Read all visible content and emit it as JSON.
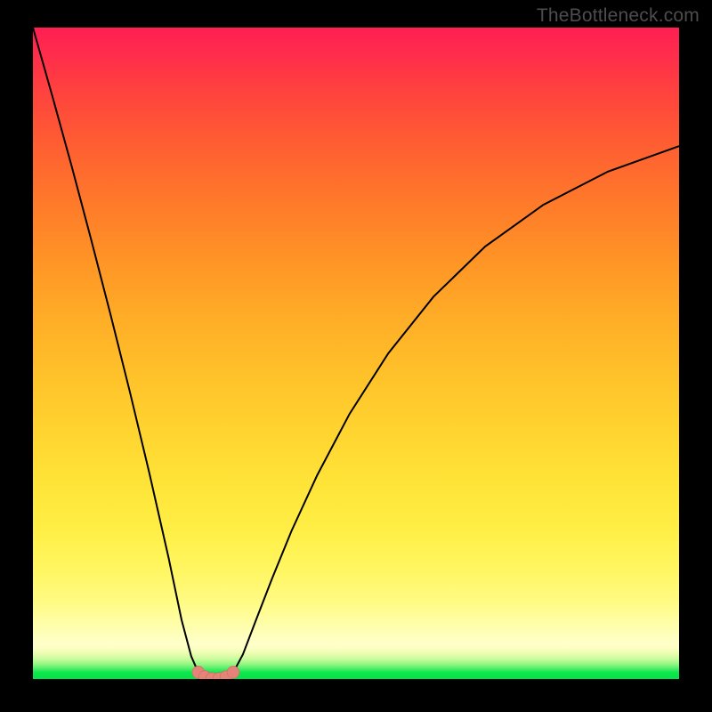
{
  "watermark": "TheBottleneck.com",
  "colors": {
    "frame": "#000000",
    "curve": "#000000",
    "marker_fill": "#e48377",
    "marker_stroke": "#cf6b60"
  },
  "chart_data": {
    "type": "line",
    "title": "",
    "xlabel": "",
    "ylabel": "",
    "xlim": [
      0,
      100
    ],
    "ylim": [
      0,
      100
    ],
    "note": "Two monotone curves meeting near x≈25–31 at y≈0 with a short flat-bottom arc. Values estimated from pixel positions; no labeled axes.",
    "series": [
      {
        "name": "left-branch",
        "x": [
          0,
          3,
          6,
          9,
          12,
          15,
          18,
          21,
          23,
          24.5,
          25.6
        ],
        "y": [
          100,
          89.5,
          78.7,
          67.5,
          56.0,
          44.1,
          31.7,
          18.6,
          9.1,
          3.5,
          1.0
        ]
      },
      {
        "name": "right-branch",
        "x": [
          31.0,
          32.5,
          34.5,
          37,
          40,
          44,
          49,
          55,
          62,
          70,
          79,
          89,
          100
        ],
        "y": [
          1.0,
          3.8,
          9.0,
          15.4,
          22.7,
          31.3,
          40.7,
          50.0,
          58.7,
          66.4,
          72.8,
          77.9,
          81.8
        ]
      },
      {
        "name": "valley-arc",
        "x": [
          25.6,
          26.5,
          27.6,
          28.7,
          29.8,
          31.0
        ],
        "y": [
          1.0,
          0.35,
          0.05,
          0.05,
          0.35,
          1.0
        ]
      }
    ],
    "markers": {
      "name": "valley-markers",
      "x": [
        25.6,
        26.6,
        27.7,
        28.8,
        29.9,
        31.0
      ],
      "y": [
        1.05,
        0.35,
        0.05,
        0.05,
        0.35,
        1.05
      ],
      "r_percent": 0.95
    }
  }
}
